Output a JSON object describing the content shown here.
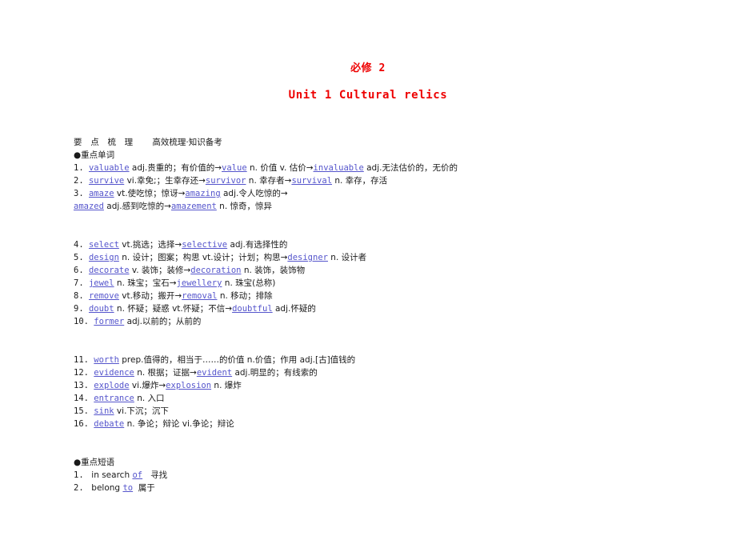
{
  "document": {
    "title_main": "必修 2",
    "title_sub": "Unit 1  Cultural relics",
    "accent_red": "#ee0000",
    "keyword_blue": "#5555cc"
  },
  "section_header": {
    "label": "要 点 梳 理",
    "tagline": "高效梳理·知识备考"
  },
  "words_section": {
    "heading": "●重点单词",
    "entries": [
      {
        "num": "1.",
        "parts": [
          {
            "t": "kw",
            "v": "valuable"
          },
          {
            "t": "txt",
            "v": " adj.贵重的；有价值的→"
          },
          {
            "t": "kw",
            "v": "value"
          },
          {
            "t": "txt",
            "v": " n. 价值 v. 估价→"
          },
          {
            "t": "kw",
            "v": "invaluable"
          },
          {
            "t": "txt",
            "v": " adj.无法估价的，无价的"
          }
        ]
      },
      {
        "num": "2.",
        "parts": [
          {
            "t": "kw",
            "v": "survive"
          },
          {
            "t": "txt",
            "v": " vi.幸免;；生幸存还→"
          },
          {
            "t": "kw",
            "v": "survivor"
          },
          {
            "t": "txt",
            "v": " n. 幸存者→"
          },
          {
            "t": "kw",
            "v": "survival"
          },
          {
            "t": "txt",
            "v": " n. 幸存，存活"
          }
        ]
      },
      {
        "num": "3.",
        "parts": [
          {
            "t": "kw",
            "v": "amaze"
          },
          {
            "t": "txt",
            "v": " vt.使吃惊；惊讶→"
          },
          {
            "t": "kw",
            "v": "amazing"
          },
          {
            "t": "txt",
            "v": " adj.令人吃惊的→"
          }
        ]
      },
      {
        "num": "",
        "parts": [
          {
            "t": "kw",
            "v": "amazed"
          },
          {
            "t": "txt",
            "v": " adj.感到吃惊的→"
          },
          {
            "t": "kw",
            "v": "amazement"
          },
          {
            "t": "txt",
            "v": " n. 惊奇，惊异"
          }
        ]
      }
    ],
    "entries_group2": [
      {
        "num": "4.",
        "parts": [
          {
            "t": "kw",
            "v": "select"
          },
          {
            "t": "txt",
            "v": " vt.挑选；选择→"
          },
          {
            "t": "kw",
            "v": "selective"
          },
          {
            "t": "txt",
            "v": " adj.有选择性的"
          }
        ]
      },
      {
        "num": "5.",
        "parts": [
          {
            "t": "kw",
            "v": "design"
          },
          {
            "t": "txt",
            "v": " n. 设计；图案；构思 vt.设计；计划；构思→"
          },
          {
            "t": "kw",
            "v": "designer"
          },
          {
            "t": "txt",
            "v": " n. 设计者"
          }
        ]
      },
      {
        "num": "6.",
        "parts": [
          {
            "t": "kw",
            "v": "decorate"
          },
          {
            "t": "txt",
            "v": " v. 装饰；装修→"
          },
          {
            "t": "kw",
            "v": "decoration"
          },
          {
            "t": "txt",
            "v": " n. 装饰，装饰物"
          }
        ]
      },
      {
        "num": "7.",
        "parts": [
          {
            "t": "kw",
            "v": "jewel"
          },
          {
            "t": "txt",
            "v": " n. 珠宝；宝石→"
          },
          {
            "t": "kw",
            "v": "jewellery"
          },
          {
            "t": "txt",
            "v": " n. 珠宝(总称)"
          }
        ]
      },
      {
        "num": "8.",
        "parts": [
          {
            "t": "kw",
            "v": "remove"
          },
          {
            "t": "txt",
            "v": " vt.移动；搬开→"
          },
          {
            "t": "kw",
            "v": "removal"
          },
          {
            "t": "txt",
            "v": " n. 移动；排除"
          }
        ]
      },
      {
        "num": "9.",
        "parts": [
          {
            "t": "kw",
            "v": "doubt"
          },
          {
            "t": "txt",
            "v": " n. 怀疑；疑惑 vt.怀疑；不信→"
          },
          {
            "t": "kw",
            "v": "doubtful"
          },
          {
            "t": "txt",
            "v": " adj.怀疑的"
          }
        ]
      },
      {
        "num": "10.",
        "parts": [
          {
            "t": "kw",
            "v": "former"
          },
          {
            "t": "txt",
            "v": " adj.以前的；从前的"
          }
        ]
      }
    ],
    "entries_group3": [
      {
        "num": "11.",
        "parts": [
          {
            "t": "kw",
            "v": "worth"
          },
          {
            "t": "txt",
            "v": " prep.值得的，相当于……的价值 n.价值；作用 adj.[古]值钱的"
          }
        ]
      },
      {
        "num": "12.",
        "parts": [
          {
            "t": "kw",
            "v": "evidence"
          },
          {
            "t": "txt",
            "v": " n. 根据；证据→"
          },
          {
            "t": "kw",
            "v": "evident"
          },
          {
            "t": "txt",
            "v": " adj.明显的；有线索的"
          }
        ]
      },
      {
        "num": "13.",
        "parts": [
          {
            "t": "kw",
            "v": "explode"
          },
          {
            "t": "txt",
            "v": " vi.爆炸→"
          },
          {
            "t": "kw",
            "v": "explosion"
          },
          {
            "t": "txt",
            "v": " n. 爆炸"
          }
        ]
      },
      {
        "num": "14.",
        "parts": [
          {
            "t": "kw",
            "v": "entrance"
          },
          {
            "t": "txt",
            "v": " n. 入口"
          }
        ]
      },
      {
        "num": "15.",
        "parts": [
          {
            "t": "kw",
            "v": "sink"
          },
          {
            "t": "txt",
            "v": " vi.下沉；沉下"
          }
        ]
      },
      {
        "num": "16.",
        "parts": [
          {
            "t": "kw",
            "v": "debate"
          },
          {
            "t": "txt",
            "v": " n. 争论；辩论 vi.争论；辩论"
          }
        ]
      }
    ]
  },
  "phrases_section": {
    "heading": "●重点短语",
    "entries": [
      {
        "num": "1.",
        "parts": [
          {
            "t": "txt",
            "v": " in search "
          },
          {
            "t": "kw",
            "v": "of"
          },
          {
            "t": "txt",
            "v": "   寻找"
          }
        ]
      },
      {
        "num": "2.",
        "parts": [
          {
            "t": "txt",
            "v": " belong "
          },
          {
            "t": "kw",
            "v": "to"
          },
          {
            "t": "txt",
            "v": "  属于"
          }
        ]
      }
    ]
  }
}
